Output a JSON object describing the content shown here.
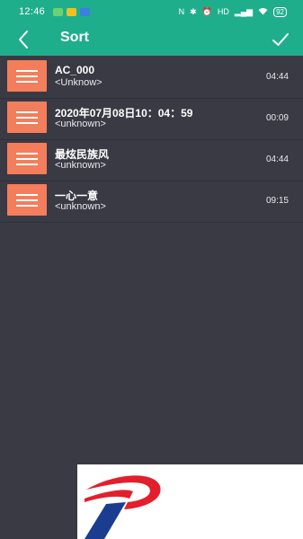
{
  "status_bar": {
    "time": "12:46",
    "network": "HD",
    "battery": "92",
    "icons": [
      "phone-icon",
      "message-icon",
      "app-icon",
      "nfc-icon",
      "bluetooth-icon",
      "alarm-icon",
      "signal-icon",
      "wifi-icon",
      "battery-icon"
    ]
  },
  "toolbar": {
    "title": "Sort",
    "back_icon": "back-chevron-icon",
    "confirm_icon": "checkmark-icon"
  },
  "songs": [
    {
      "title": "AC_000",
      "artist": "<Unknow>",
      "duration": "04:44"
    },
    {
      "title": "2020年07月08日10：04：59",
      "artist": "<unknown>",
      "duration": "00:09"
    },
    {
      "title": "最炫民族风",
      "artist": "<unknown>",
      "duration": "04:44"
    },
    {
      "title": "一心一意",
      "artist": "<unknown>",
      "duration": "09:15"
    }
  ],
  "colors": {
    "accent": "#1fae8c",
    "background": "#3a3a44",
    "handle": "#f47d5b",
    "logo_red": "#e2202b",
    "logo_blue": "#1a3d8f"
  }
}
